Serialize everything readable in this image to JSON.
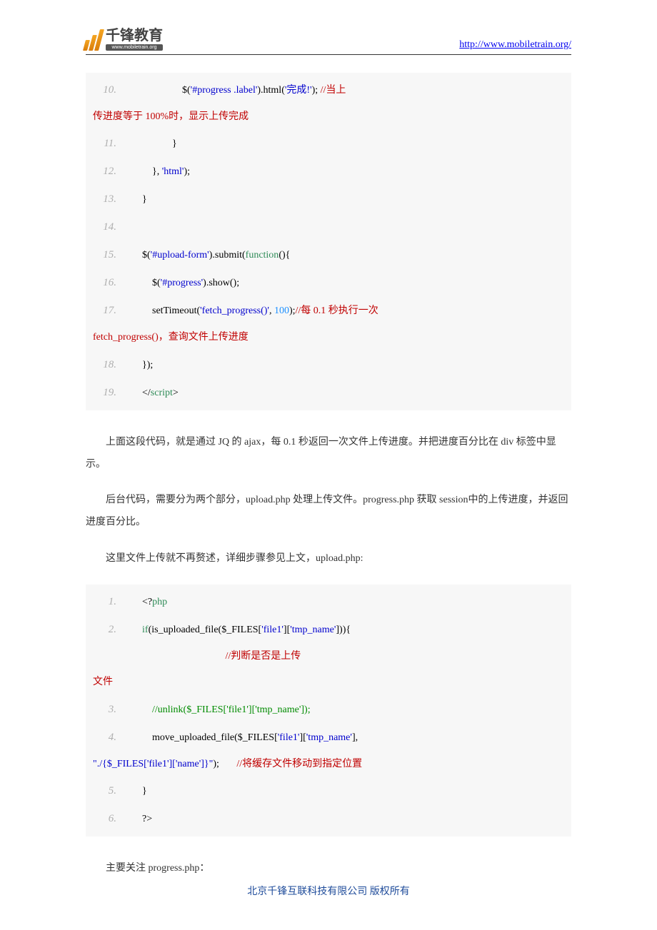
{
  "header": {
    "logo_main": "千锋教育",
    "logo_sub": "www.mobiletrain.org",
    "url": "http://www.mobiletrain.org/"
  },
  "code1": {
    "lines": [
      {
        "n": "10.",
        "parts": [
          {
            "c": "c-black",
            "t": "                    $("
          },
          {
            "c": "c-blue",
            "t": "'#progress .label'"
          },
          {
            "c": "c-black",
            "t": ").html("
          },
          {
            "c": "c-blue",
            "t": "'完成!'"
          },
          {
            "c": "c-black",
            "t": "); "
          },
          {
            "c": "c-red-comment",
            "t": "//当上"
          }
        ]
      },
      {
        "n": "",
        "parts": [
          {
            "c": "c-red-comment",
            "t": "传进度等于 100%时，显示上传完成"
          }
        ],
        "wrap": true
      },
      {
        "n": "11.",
        "parts": [
          {
            "c": "c-black",
            "t": "                }"
          }
        ]
      },
      {
        "n": "12.",
        "parts": [
          {
            "c": "c-black",
            "t": "        }, "
          },
          {
            "c": "c-blue",
            "t": "'html'"
          },
          {
            "c": "c-black",
            "t": ");"
          }
        ]
      },
      {
        "n": "13.",
        "parts": [
          {
            "c": "c-black",
            "t": "    }"
          }
        ]
      },
      {
        "n": "14.",
        "parts": [
          {
            "c": "c-black",
            "t": " "
          }
        ]
      },
      {
        "n": "15.",
        "parts": [
          {
            "c": "c-black",
            "t": "    $("
          },
          {
            "c": "c-blue",
            "t": "'#upload-form'"
          },
          {
            "c": "c-black",
            "t": ").submit("
          },
          {
            "c": "c-green",
            "t": "function"
          },
          {
            "c": "c-black",
            "t": "(){"
          }
        ]
      },
      {
        "n": "16.",
        "parts": [
          {
            "c": "c-black",
            "t": "        $("
          },
          {
            "c": "c-blue",
            "t": "'#progress'"
          },
          {
            "c": "c-black",
            "t": ").show();"
          }
        ]
      },
      {
        "n": "17.",
        "parts": [
          {
            "c": "c-black",
            "t": "        setTimeout("
          },
          {
            "c": "c-blue",
            "t": "'fetch_progress()'"
          },
          {
            "c": "c-black",
            "t": ", "
          },
          {
            "c": "c-cyan",
            "t": "100"
          },
          {
            "c": "c-black",
            "t": ");"
          },
          {
            "c": "c-red-comment",
            "t": "//每 0.1 秒执行一次"
          }
        ]
      },
      {
        "n": "",
        "parts": [
          {
            "c": "c-red-comment",
            "t": "fetch_progress()，查询文件上传进度"
          }
        ],
        "wrap": true
      },
      {
        "n": "18.",
        "parts": [
          {
            "c": "c-black",
            "t": "    });"
          }
        ]
      },
      {
        "n": "19.",
        "parts": [
          {
            "c": "c-black",
            "t": "    </"
          },
          {
            "c": "c-green",
            "t": "script"
          },
          {
            "c": "c-black",
            "t": ">"
          }
        ]
      }
    ]
  },
  "para1": "上面这段代码，就是通过 JQ 的 ajax，每 0.1 秒返回一次文件上传进度。并把进度百分比在 div 标签中显示。",
  "para2": "后台代码，需要分为两个部分，upload.php 处理上传文件。progress.php 获取 session中的上传进度，并返回进度百分比。",
  "para3": "这里文件上传就不再赘述，详细步骤参见上文，upload.php:",
  "code2": {
    "lines": [
      {
        "n": "1.",
        "parts": [
          {
            "c": "c-black",
            "t": "    <?"
          },
          {
            "c": "c-green",
            "t": "php"
          }
        ]
      },
      {
        "n": "2.",
        "parts": [
          {
            "c": "c-black",
            "t": "    "
          },
          {
            "c": "c-green",
            "t": "if"
          },
          {
            "c": "c-black",
            "t": "(is_uploaded_file($_FILES["
          },
          {
            "c": "c-blue",
            "t": "'file1'"
          },
          {
            "c": "c-black",
            "t": "]["
          },
          {
            "c": "c-blue",
            "t": "'tmp_name'"
          },
          {
            "c": "c-black",
            "t": "])){"
          }
        ]
      },
      {
        "n": "",
        "parts": [
          {
            "c": "c-black",
            "t": "                                                     "
          },
          {
            "c": "c-red-comment",
            "t": "//判断是否是上传"
          }
        ],
        "wrap": true
      },
      {
        "n": "",
        "parts": [
          {
            "c": "c-red-comment",
            "t": "文件"
          }
        ],
        "wrap": true
      },
      {
        "n": "3.",
        "parts": [
          {
            "c": "c-black",
            "t": "        "
          },
          {
            "c": "c-comment",
            "t": "//unlink($_FILES['file1']['tmp_name']);"
          }
        ]
      },
      {
        "n": "4.",
        "parts": [
          {
            "c": "c-black",
            "t": "        move_uploaded_file($_FILES["
          },
          {
            "c": "c-blue",
            "t": "'file1'"
          },
          {
            "c": "c-black",
            "t": "]["
          },
          {
            "c": "c-blue",
            "t": "'tmp_name'"
          },
          {
            "c": "c-black",
            "t": "],"
          }
        ]
      },
      {
        "n": "",
        "parts": [
          {
            "c": "c-blue",
            "t": "\"./{$_FILES['file1']['name']}\""
          },
          {
            "c": "c-black",
            "t": ");       "
          },
          {
            "c": "c-red-comment",
            "t": "//将缓存文件移动到指定位置"
          }
        ],
        "wrap": true
      },
      {
        "n": "5.",
        "parts": [
          {
            "c": "c-black",
            "t": "    }"
          }
        ]
      },
      {
        "n": "6.",
        "parts": [
          {
            "c": "c-black",
            "t": "    ?>"
          }
        ]
      }
    ]
  },
  "para4": "主要关注 progress.php：",
  "footer": "北京千锋互联科技有限公司 版权所有"
}
